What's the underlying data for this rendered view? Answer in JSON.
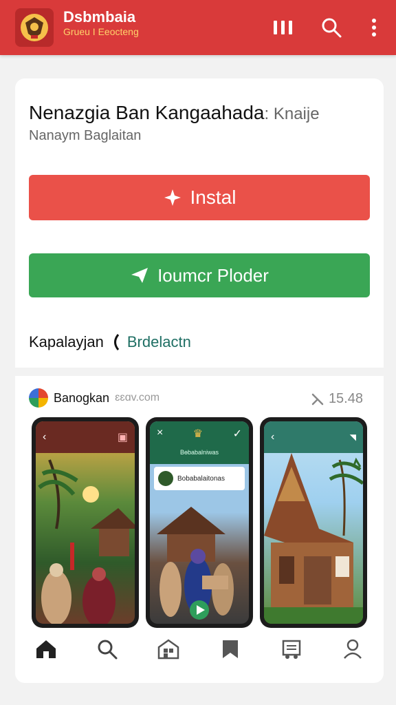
{
  "header": {
    "title": "Dsbmbaia",
    "subtitle": "Grueu I Eeocteng",
    "menu_icon": "columns-icon",
    "search_icon": "search-icon",
    "more_icon": "more-vertical-icon"
  },
  "app": {
    "title": "Nenazgia Ban Kangaahada",
    "title_suffix": ": Knaije",
    "subtitle": "Nanaym Baglaitan",
    "install_label": "Instal",
    "secondary_label": "Ioumcr Ploder",
    "category_label": "Kapalayjan",
    "category_link": "Brdelactn"
  },
  "developer": {
    "name": "Banogkan",
    "url": "ɛɛɑv.com",
    "size": "15.48"
  },
  "screenshots": [
    {
      "caption": ""
    },
    {
      "header_text": "Bɵbabalniwas",
      "card_title": "Bobabalaitonas"
    },
    {
      "caption": ""
    }
  ],
  "colors": {
    "header": "#d93a3a",
    "install": "#ea5149",
    "secondary": "#3aa655",
    "link": "#1f6f64"
  },
  "bottom_nav": [
    "home-icon",
    "search-icon",
    "apps-icon",
    "bookmark-icon",
    "library-icon",
    "profile-icon"
  ]
}
